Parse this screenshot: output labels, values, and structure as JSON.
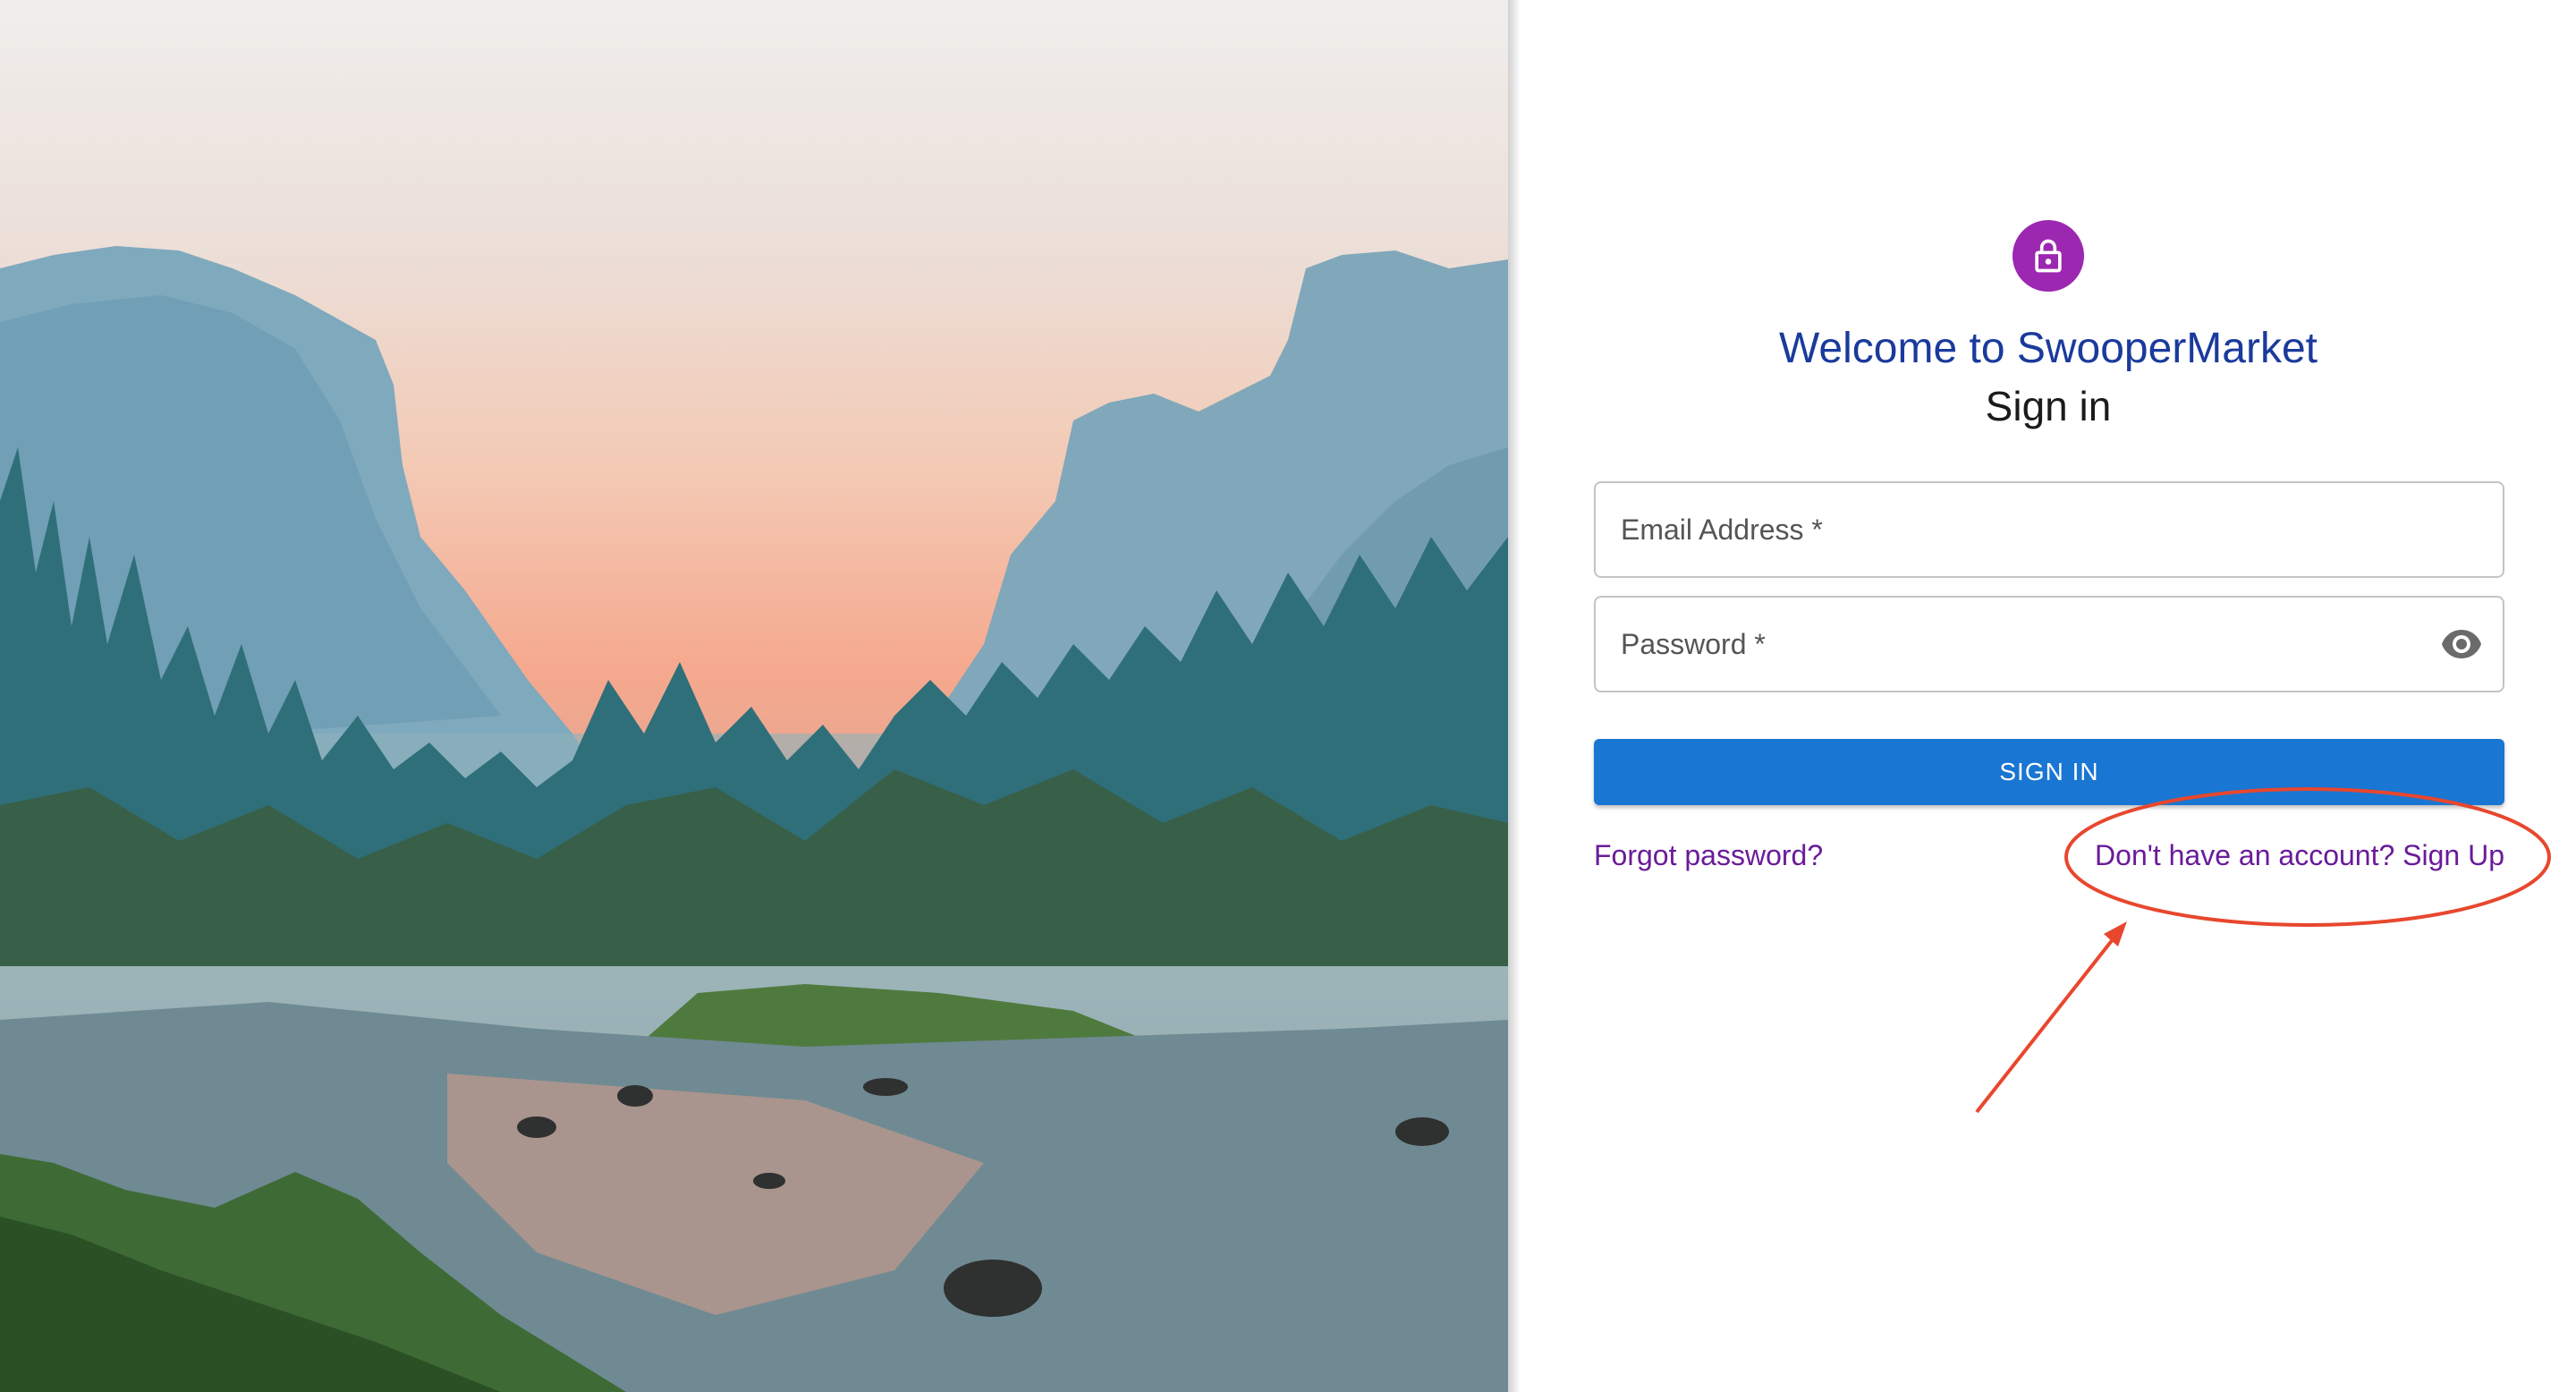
{
  "welcome_title": "Welcome to SwooperMarket",
  "signin_title": "Sign in",
  "email_field": {
    "label": "Email Address *",
    "value": ""
  },
  "password_field": {
    "label": "Password *",
    "value": ""
  },
  "signin_button_label": "SIGN IN",
  "forgot_password_link": "Forgot password?",
  "signup_link": "Don't have an account? Sign Up",
  "icons": {
    "avatar": "lock-icon",
    "password_toggle": "eye-icon"
  },
  "colors": {
    "accent_purple": "#9c27b0",
    "primary_blue": "#1976d2",
    "title_blue": "#1a3a9c",
    "link_purple": "#6a1b9a",
    "annotation_red": "#e8472e"
  }
}
